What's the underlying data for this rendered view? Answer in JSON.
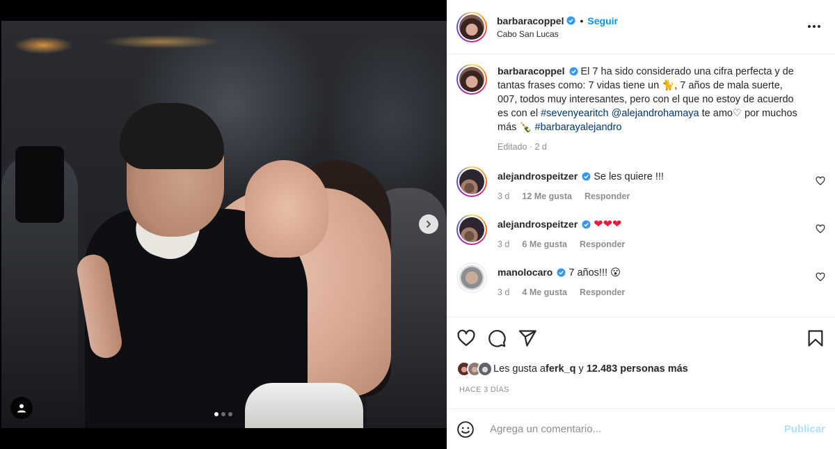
{
  "post": {
    "author": "barbaracoppel",
    "location": "Cabo San Lucas",
    "follow_label": "Seguir",
    "separator": "•",
    "caption": {
      "text_1": "El 7 ha sido considerado una cifra perfecta y de tantas frases como: 7 vidas tiene un ",
      "emoji_cat": "🐈",
      "text_2": ", 7 años de mala suerte, 007, todos muy interesantes, pero con el que no estoy de acuerdo es con el ",
      "hashtag_1": "#sevenyearitch",
      "mention": "@alejandrohamaya",
      "text_3": " te amo",
      "emoji_heart": "♡",
      "text_4": " por muchos más ",
      "emoji_bottle": "🍾",
      "hashtag_2": "#barbarayalejandro",
      "meta": "Editado · 2 d"
    },
    "carousel": {
      "slides": 3,
      "active_index": 0
    }
  },
  "comments": [
    {
      "user": "alejandrospeitzer",
      "text": "Se les quiere !!!",
      "time": "3 d",
      "likes": "12 Me gusta",
      "reply": "Responder",
      "verified": true
    },
    {
      "user": "alejandrospeitzer",
      "text": "❤❤❤",
      "time": "3 d",
      "likes": "6 Me gusta",
      "reply": "Responder",
      "verified": true
    },
    {
      "user": "manolocaro",
      "text": "7 años!!! 😮",
      "time": "3 d",
      "likes": "4 Me gusta",
      "reply": "Responder",
      "verified": true
    }
  ],
  "likes": {
    "prefix": "Les gusta a ",
    "first_user": "ferk_q",
    "joiner": " y ",
    "others": "12.483 personas más"
  },
  "date_label": "HACE 3 DÍAS",
  "add_comment": {
    "placeholder": "Agrega un comentario...",
    "publish_label": "Publicar"
  },
  "colors": {
    "accent_blue": "#0095f6",
    "link_blue": "#00376b",
    "publish_disabled": "#b2dffc",
    "verified_blue": "#3897f0",
    "heart_red": "#ed1a3a"
  },
  "icons": [
    "like-icon",
    "comment-icon",
    "share-icon",
    "save-icon",
    "emoji-icon",
    "more-options-icon",
    "chevron-right-icon",
    "user-tag-icon",
    "verified-icon"
  ]
}
